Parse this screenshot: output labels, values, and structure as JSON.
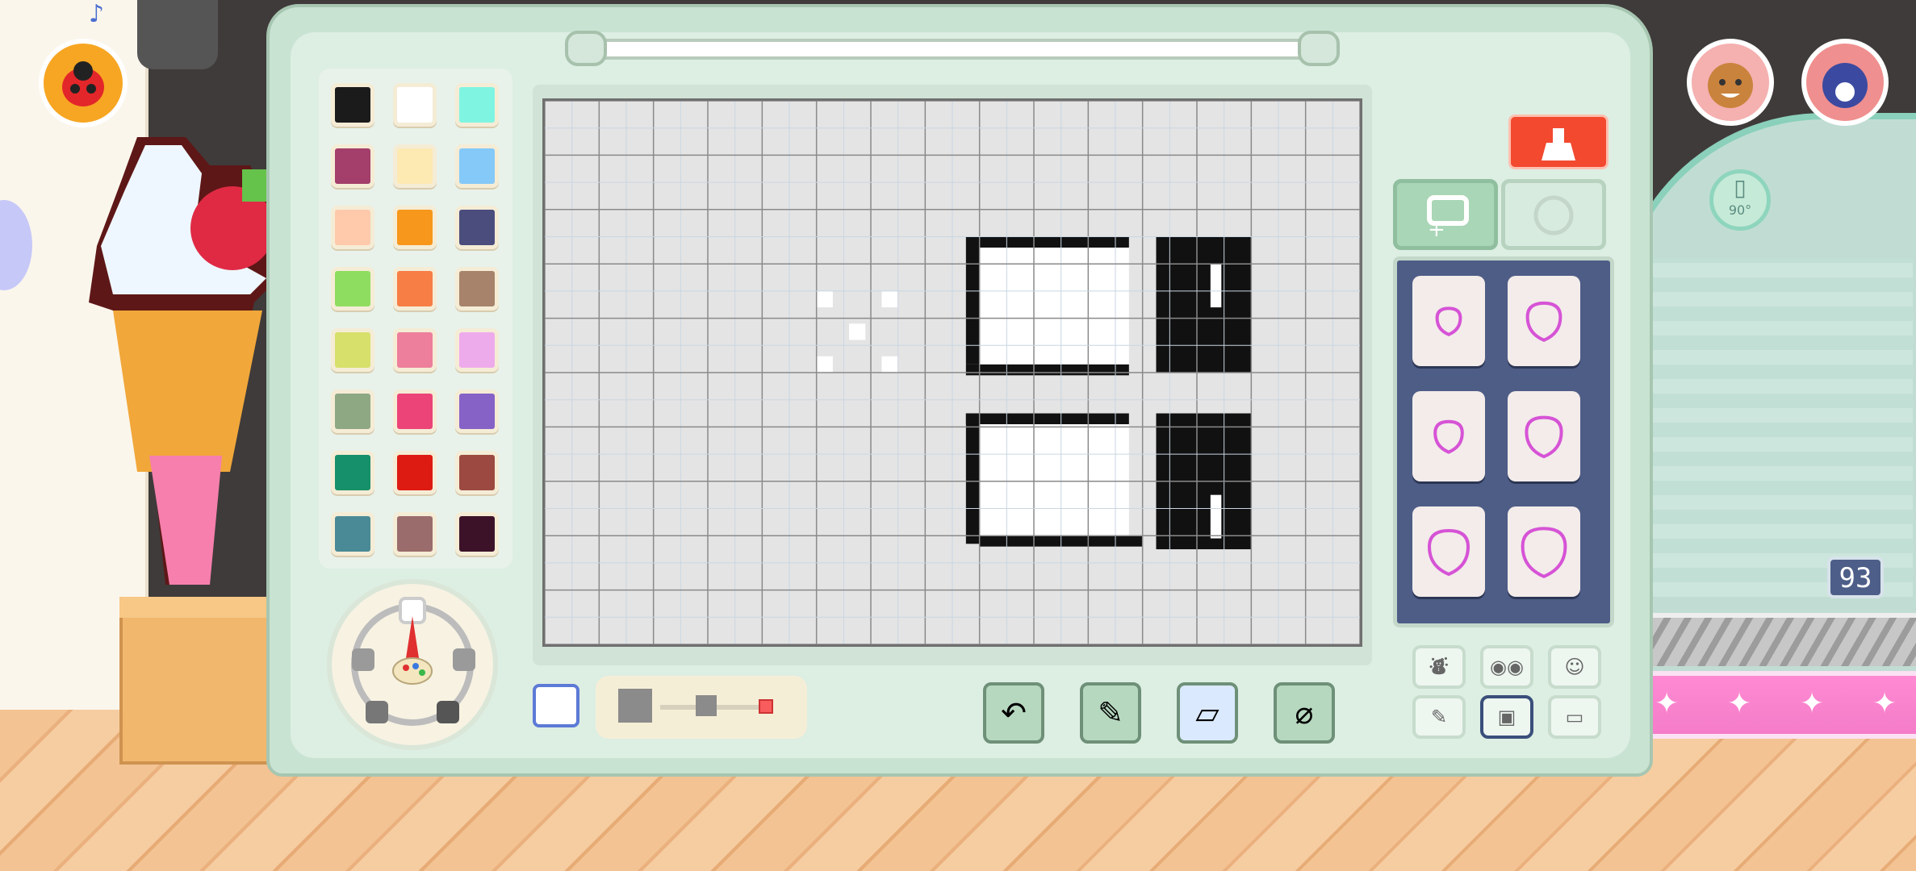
{
  "palette": {
    "colors": [
      "#1b1b1b",
      "#ffffff",
      "#7ff5e1",
      "#a33f6a",
      "#fde9b2",
      "#85c9f8",
      "#ffc9ac",
      "#f7971b",
      "#4b4d7d",
      "#8fdd60",
      "#f77e45",
      "#a7836b",
      "#d7e06a",
      "#ed7f9c",
      "#eeabeb",
      "#8fa884",
      "#ec4479",
      "#8662c7",
      "#16906a",
      "#dd1b12",
      "#9c4a41",
      "#4a8a96",
      "#9a6c6c",
      "#3c1229"
    ]
  },
  "canvas": {
    "cols": 30,
    "rows": 20,
    "background": "#e4e4e4",
    "drawing_colors": {
      "black": "#111111",
      "white": "#ffffff"
    }
  },
  "tools": {
    "clear_icon": "broom-icon",
    "add_tab_icon": "add-frame-icon",
    "rotate_tab_icon": "rotate-icon",
    "undo_icon": "undo-icon",
    "fill_icon": "spray-icon",
    "eraser_icon": "eraser-icon",
    "eyedropper_icon": "eyedropper-icon"
  },
  "stickers": {
    "items": [
      "strawberry-small",
      "strawberry-medium",
      "strawberry-3d-small",
      "strawberry-3d-medium",
      "strawberry-large",
      "strawberry-3d-large"
    ]
  },
  "bottom_buttons": [
    "dress-icon",
    "eyes-icon",
    "face-icon",
    "pencil-icon",
    "layers-icon",
    "folder-icon"
  ],
  "rotate_label": "90°",
  "counter": "93",
  "music_icon": "♪"
}
